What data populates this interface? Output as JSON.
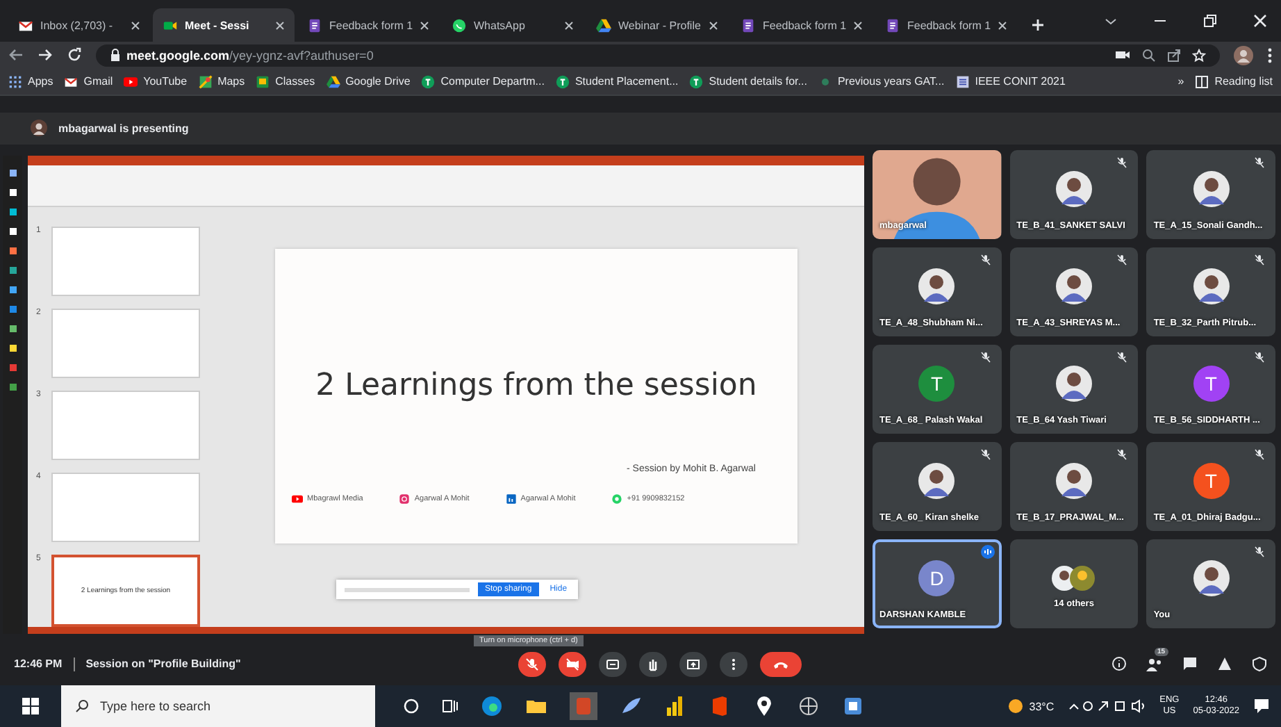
{
  "tabs": [
    {
      "title": "Inbox (2,703) - ",
      "kind": "mail",
      "selected": false
    },
    {
      "title": "Meet - Sessi",
      "kind": "meet",
      "selected": true
    },
    {
      "title": "Feedback form 1",
      "kind": "form",
      "selected": false
    },
    {
      "title": "WhatsApp",
      "kind": "chat",
      "selected": false
    },
    {
      "title": "Webinar - Profile",
      "kind": "drive",
      "selected": false
    },
    {
      "title": "Feedback form 1",
      "kind": "form",
      "selected": false
    },
    {
      "title": "Feedback form 1",
      "kind": "form",
      "selected": false
    }
  ],
  "address": {
    "domain": "meet.google.com",
    "path": "/yey-ygnz-avf?authuser=0"
  },
  "bookmarks": [
    {
      "label": "Apps",
      "kind": "apps"
    },
    {
      "label": "Gmail",
      "kind": "mail"
    },
    {
      "label": "YouTube",
      "kind": "video"
    },
    {
      "label": "Maps",
      "kind": "map"
    },
    {
      "label": "Classes",
      "kind": "class"
    },
    {
      "label": "Google Drive",
      "kind": "drive"
    },
    {
      "label": "Computer Departm...",
      "kind": "sheet"
    },
    {
      "label": "Student Placement...",
      "kind": "sheet"
    },
    {
      "label": "Student details for...",
      "kind": "sheet"
    },
    {
      "label": "Previous years GAT...",
      "kind": "dot"
    },
    {
      "label": "IEEE CONIT 2021",
      "kind": "doc"
    }
  ],
  "bookmarks_more": "»",
  "reading_list": "Reading list",
  "presenting": "mbagarwal is presenting",
  "slides": {
    "thumbnails": [
      {
        "number": "1",
        "selected": false
      },
      {
        "number": "2",
        "selected": false
      },
      {
        "number": "3",
        "selected": false
      },
      {
        "number": "4",
        "selected": false
      },
      {
        "number": "5",
        "title": "2 Learnings from the session",
        "selected": true
      }
    ],
    "title": "2 Learnings from the session",
    "byline": "- Session by Mohit B. Agarwal",
    "footer": [
      {
        "kind": "video",
        "text": "Mbagrawl Media"
      },
      {
        "kind": "camera",
        "text": "Agarwal A Mohit"
      },
      {
        "kind": "in",
        "text": "Agarwal A Mohit"
      },
      {
        "kind": "phone",
        "text": "+91 9909832152"
      }
    ],
    "share_notice": {
      "button": "Stop sharing",
      "hide": "Hide"
    }
  },
  "participants": [
    {
      "name": "mbagarwal",
      "kind": "video",
      "muted": false,
      "speaking": false
    },
    {
      "name": "TE_B_41_SANKET SALVI",
      "muted": true,
      "speaking": false
    },
    {
      "name": "TE_A_15_Sonali Gandh...",
      "muted": true,
      "speaking": false
    },
    {
      "name": "TE_A_48_Shubham Ni...",
      "muted": true,
      "speaking": false
    },
    {
      "name": "TE_A_43_SHREYAS M...",
      "muted": true,
      "speaking": false
    },
    {
      "name": "TE_B_32_Parth Pitrub...",
      "muted": true,
      "speaking": false
    },
    {
      "name": "TE_A_68_ Palash Wakal",
      "kind": "letter",
      "letter": "T",
      "color": "#1e8e3e",
      "muted": true,
      "speaking": false
    },
    {
      "name": "TE_B_64 Yash Tiwari",
      "muted": true,
      "speaking": false
    },
    {
      "name": "TE_B_56_SIDDHARTH ...",
      "kind": "letter",
      "letter": "T",
      "color": "#a142f4",
      "muted": true,
      "speaking": false
    },
    {
      "name": "TE_A_60_ Kiran shelke",
      "muted": true,
      "speaking": false
    },
    {
      "name": "TE_B_17_PRAJWAL_M...",
      "muted": true,
      "speaking": false
    },
    {
      "name": "TE_A_01_Dhiraj Badgu...",
      "kind": "letter",
      "letter": "T",
      "color": "#f4511e",
      "muted": true,
      "speaking": false
    },
    {
      "name": "DARSHAN KAMBLE",
      "kind": "letter",
      "letter": "D",
      "color": "#7986cb",
      "muted": false,
      "speaking": true
    },
    {
      "name": "14 others",
      "kind": "others",
      "muted": false,
      "speaking": false
    },
    {
      "name": "You",
      "muted": true,
      "speaking": false
    }
  ],
  "meeting": {
    "time": "12:46 PM",
    "title": "Session on \"Profile Building\"",
    "tooltip": "Turn on microphone (ctrl + d)",
    "controls": [
      {
        "kind": "mic",
        "on": false
      },
      {
        "kind": "camera",
        "on": false
      },
      {
        "kind": "captions"
      },
      {
        "kind": "hand"
      },
      {
        "kind": "present"
      },
      {
        "kind": "more"
      },
      {
        "kind": "leave"
      }
    ],
    "people_count": "15"
  },
  "taskbar": {
    "search_placeholder": "Type here to search",
    "temperature": "33°C",
    "language": "ENG",
    "region": "US",
    "time": "12:46",
    "date": "05-03-2022"
  }
}
